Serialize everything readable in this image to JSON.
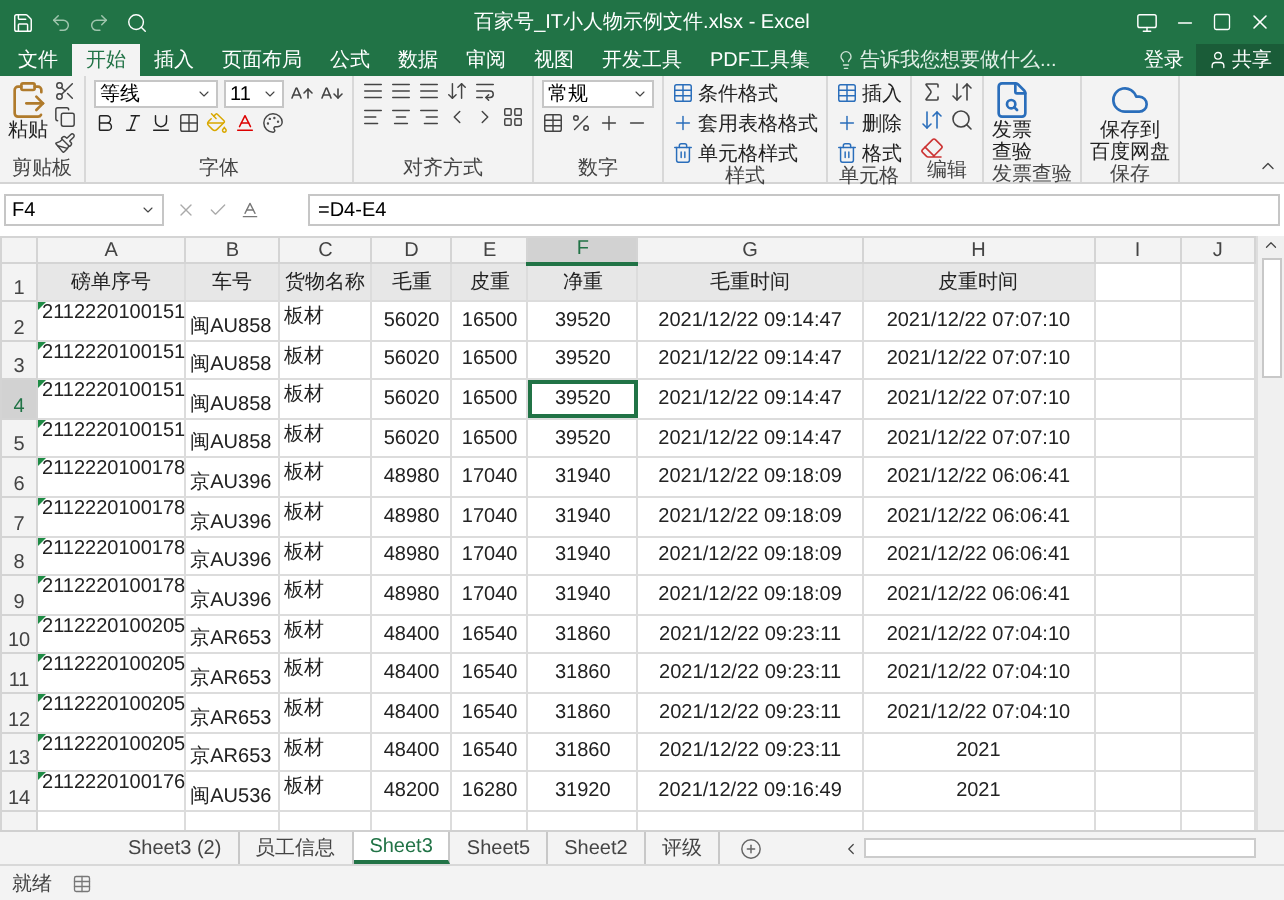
{
  "window": {
    "title": "百家号_IT小人物示例文件.xlsx - Excel"
  },
  "ribbon_tabs": [
    {
      "label": "文件",
      "selected": false
    },
    {
      "label": "开始",
      "selected": true
    },
    {
      "label": "插入",
      "selected": false
    },
    {
      "label": "页面布局",
      "selected": false
    },
    {
      "label": "公式",
      "selected": false
    },
    {
      "label": "数据",
      "selected": false
    },
    {
      "label": "审阅",
      "selected": false
    },
    {
      "label": "视图",
      "selected": false
    },
    {
      "label": "开发工具",
      "selected": false
    },
    {
      "label": "PDF工具集",
      "selected": false
    }
  ],
  "tell_me": {
    "placeholder": "告诉我您想要做什么..."
  },
  "account": {
    "sign_in": "登录",
    "share": "共享"
  },
  "ribbon_groups": [
    {
      "kind": "clipboard",
      "label": "剪贴板",
      "button": "粘贴"
    },
    {
      "kind": "font",
      "label": "字体",
      "font": "等线",
      "size": "11"
    },
    {
      "kind": "align",
      "label": "对齐方式"
    },
    {
      "kind": "number",
      "label": "数字",
      "format": "常规"
    },
    {
      "kind": "list",
      "label": "样式",
      "items": [
        "条件格式",
        "套用表格格式",
        "单元格样式"
      ]
    },
    {
      "kind": "list",
      "label": "单元格",
      "items": [
        "插入",
        "删除",
        "格式"
      ]
    },
    {
      "kind": "edit",
      "label": "编辑"
    },
    {
      "kind": "big",
      "label": "发票查验",
      "lines": [
        "发票",
        "查验"
      ]
    },
    {
      "kind": "big",
      "label": "保存",
      "lines": [
        "保存到",
        "百度网盘"
      ]
    }
  ],
  "formula_bar": {
    "name_box": "F4",
    "formula": "=D4-E4"
  },
  "columns": [
    {
      "label": "A",
      "selected": false
    },
    {
      "label": "B",
      "selected": false
    },
    {
      "label": "C",
      "selected": false
    },
    {
      "label": "D",
      "selected": false
    },
    {
      "label": "E",
      "selected": false
    },
    {
      "label": "F",
      "selected": true
    },
    {
      "label": "G",
      "selected": false
    },
    {
      "label": "H",
      "selected": false
    },
    {
      "label": "I",
      "selected": false
    },
    {
      "label": "J",
      "selected": false
    }
  ],
  "rows": [
    {
      "number": "1",
      "selected": false,
      "kind": "header",
      "flagged": false,
      "cells": [
        "磅单序号",
        "车号",
        "货物名称",
        "毛重",
        "皮重",
        "净重",
        "毛重时间",
        "皮重时间"
      ]
    },
    {
      "number": "2",
      "selected": false,
      "kind": "data",
      "flagged": true,
      "cells": [
        "2112220100151",
        "闽AU858",
        "板材",
        "56020",
        "16500",
        "39520",
        "2021/12/22 09:14:47",
        "2021/12/22 07:07:10"
      ]
    },
    {
      "number": "3",
      "selected": false,
      "kind": "data",
      "flagged": true,
      "cells": [
        "2112220100151",
        "闽AU858",
        "板材",
        "56020",
        "16500",
        "39520",
        "2021/12/22 09:14:47",
        "2021/12/22 07:07:10"
      ]
    },
    {
      "number": "4",
      "selected": true,
      "kind": "data",
      "flagged": true,
      "cells": [
        "2112220100151",
        "闽AU858",
        "板材",
        "56020",
        "16500",
        "39520",
        "2021/12/22 09:14:47",
        "2021/12/22 07:07:10"
      ]
    },
    {
      "number": "5",
      "selected": false,
      "kind": "data",
      "flagged": true,
      "cells": [
        "2112220100151",
        "闽AU858",
        "板材",
        "56020",
        "16500",
        "39520",
        "2021/12/22 09:14:47",
        "2021/12/22 07:07:10"
      ]
    },
    {
      "number": "6",
      "selected": false,
      "kind": "data",
      "flagged": true,
      "cells": [
        "2112220100178",
        "京AU396",
        "板材",
        "48980",
        "17040",
        "31940",
        "2021/12/22 09:18:09",
        "2021/12/22 06:06:41"
      ]
    },
    {
      "number": "7",
      "selected": false,
      "kind": "data",
      "flagged": true,
      "cells": [
        "2112220100178",
        "京AU396",
        "板材",
        "48980",
        "17040",
        "31940",
        "2021/12/22 09:18:09",
        "2021/12/22 06:06:41"
      ]
    },
    {
      "number": "8",
      "selected": false,
      "kind": "data",
      "flagged": true,
      "cells": [
        "2112220100178",
        "京AU396",
        "板材",
        "48980",
        "17040",
        "31940",
        "2021/12/22 09:18:09",
        "2021/12/22 06:06:41"
      ]
    },
    {
      "number": "9",
      "selected": false,
      "kind": "data",
      "flagged": true,
      "cells": [
        "2112220100178",
        "京AU396",
        "板材",
        "48980",
        "17040",
        "31940",
        "2021/12/22 09:18:09",
        "2021/12/22 06:06:41"
      ]
    },
    {
      "number": "10",
      "selected": false,
      "kind": "data",
      "flagged": true,
      "cells": [
        "2112220100205",
        "京AR653",
        "板材",
        "48400",
        "16540",
        "31860",
        "2021/12/22 09:23:11",
        "2021/12/22 07:04:10"
      ]
    },
    {
      "number": "11",
      "selected": false,
      "kind": "data",
      "flagged": true,
      "cells": [
        "2112220100205",
        "京AR653",
        "板材",
        "48400",
        "16540",
        "31860",
        "2021/12/22 09:23:11",
        "2021/12/22 07:04:10"
      ]
    },
    {
      "number": "12",
      "selected": false,
      "kind": "data",
      "flagged": true,
      "cells": [
        "2112220100205",
        "京AR653",
        "板材",
        "48400",
        "16540",
        "31860",
        "2021/12/22 09:23:11",
        "2021/12/22 07:04:10"
      ]
    },
    {
      "number": "13",
      "selected": false,
      "kind": "data",
      "flagged": true,
      "cells": [
        "2112220100205",
        "京AR653",
        "板材",
        "48400",
        "16540",
        "31860",
        "2021/12/22 09:23:11",
        "2021"
      ]
    },
    {
      "number": "14",
      "selected": false,
      "kind": "data",
      "flagged": true,
      "cells": [
        "2112220100176",
        "闽AU536",
        "板材",
        "48200",
        "16280",
        "31920",
        "2021/12/22 09:16:49",
        "2021"
      ]
    }
  ],
  "sheet_tabs": [
    {
      "label": "Sheet3 (2)",
      "selected": false
    },
    {
      "label": "员工信息",
      "selected": false
    },
    {
      "label": "Sheet3",
      "selected": true
    },
    {
      "label": "Sheet5",
      "selected": false
    },
    {
      "label": "Sheet2",
      "selected": false
    },
    {
      "label": "评级",
      "selected": false
    }
  ],
  "status_bar": {
    "text": "就绪"
  }
}
